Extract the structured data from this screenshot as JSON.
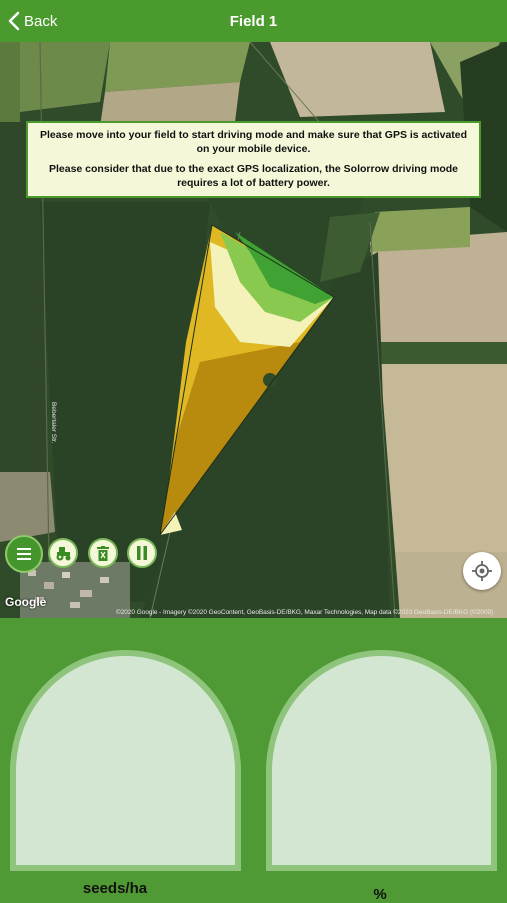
{
  "navbar": {
    "back_label": "Back",
    "title": "Field 1"
  },
  "map": {
    "info_line1": "Please move into your field to start driving mode and make sure that GPS is activated on your mobile device.",
    "info_line2": "Please consider that due to the exact GPS localization, the Solorrow driving mode requires a lot of battery power.",
    "google_label": "Google",
    "attribution": "©2020 Google - Imagery ©2020 GeoContent, GeoBasis-DE/BKG, Maxar Technologies, Map data ©2020 GeoBasis-DE/BKG (©2009)",
    "street_label": "Bebertaler Str.",
    "controls": {
      "menu_icon": "menu-icon",
      "tractor_icon": "tractor-icon",
      "delete_icon": "trash-icon",
      "pause_icon": "pause-icon",
      "locate_icon": "locate-icon"
    }
  },
  "gauges": {
    "left_unit": "seeds/ha",
    "right_unit": "%"
  },
  "colors": {
    "accent_green": "#4a9a2e",
    "panel_green": "#4f9a34",
    "gauge_fill": "#d3e6d1",
    "info_bg": "#f4f8d8"
  }
}
